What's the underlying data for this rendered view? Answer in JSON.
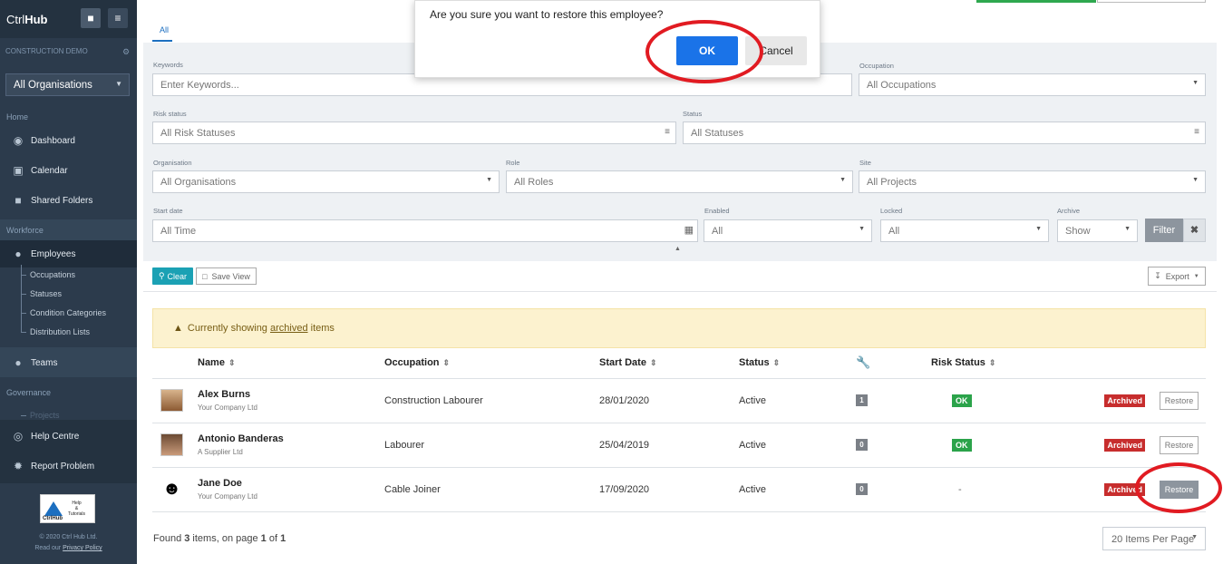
{
  "sidebar": {
    "brand_ctrl": "Ctrl",
    "brand_hub": "Hub",
    "pin_icon": "■",
    "menu_icon": "≡",
    "org_section": "CONSTRUCTION DEMO",
    "org_select": "All Organisations",
    "home_label": "Home",
    "dashboard": "Dashboard",
    "calendar": "Calendar",
    "shared_folders": "Shared Folders",
    "workforce_label": "Workforce",
    "employees": "Employees",
    "occupations": "Occupations",
    "statuses": "Statuses",
    "condition_categories": "Condition Categories",
    "distribution_lists": "Distribution Lists",
    "teams": "Teams",
    "governance_label": "Governance",
    "projects": "Projects",
    "help_centre": "Help Centre",
    "report_problem": "Report Problem",
    "help_logo_text1": "Help",
    "help_logo_text2": "&",
    "help_logo_text3": "Tutorials",
    "help_logo_caption": "CtrlHub",
    "copyright": "© 2020 Ctrl Hub Ltd.",
    "privacy_prefix": "Read our ",
    "privacy_link": "Privacy Policy"
  },
  "tabs": {
    "all": "All"
  },
  "filters": {
    "keywords_label": "Keywords",
    "keywords_placeholder": "Enter Keywords...",
    "occupation_label": "Occupation",
    "occupation_value": "All Occupations",
    "risk_status_label": "Risk status",
    "risk_status_value": "All Risk Statuses",
    "status_label": "Status",
    "status_value": "All Statuses",
    "organisation_label": "Organisation",
    "organisation_value": "All Organisations",
    "role_label": "Role",
    "role_value": "All Roles",
    "site_label": "Site",
    "site_value": "All Projects",
    "start_date_label": "Start date",
    "start_date_value": "All Time",
    "enabled_label": "Enabled",
    "enabled_value": "All",
    "locked_label": "Locked",
    "locked_value": "All",
    "archive_label": "Archive",
    "archive_value": "Show",
    "filter_button": "Filter",
    "clear_x": "✖"
  },
  "toolbar": {
    "clear": "Clear",
    "save_view": "Save View",
    "export": "Export"
  },
  "alert": {
    "prefix": "Currently showing ",
    "link": "archived",
    "suffix": " items"
  },
  "table": {
    "headers": [
      "Name",
      "Occupation",
      "Start Date",
      "Status",
      "",
      "Risk Status"
    ],
    "rows": [
      {
        "name": "Alex Burns",
        "org": "Your Company Ltd",
        "occupation": "Construction Labourer",
        "start_date": "28/01/2020",
        "status": "Active",
        "count": "1",
        "risk": "OK",
        "archived": "Archived",
        "restore": "Restore"
      },
      {
        "name": "Antonio Banderas",
        "org": "A Supplier Ltd",
        "occupation": "Labourer",
        "start_date": "25/04/2019",
        "status": "Active",
        "count": "0",
        "risk": "OK",
        "archived": "Archived",
        "restore": "Restore"
      },
      {
        "name": "Jane Doe",
        "org": "Your Company Ltd",
        "occupation": "Cable Joiner",
        "start_date": "17/09/2020",
        "status": "Active",
        "count": "0",
        "risk": "-",
        "archived": "Archived",
        "restore": "Restore"
      }
    ]
  },
  "footer": {
    "found_prefix": "Found ",
    "found_count": "3",
    "found_mid": " items, on page ",
    "page": "1",
    "found_of": " of ",
    "pages": "1",
    "per_page": "20 Items Per Page"
  },
  "dialog": {
    "message": "Are you sure you want to restore this employee?",
    "ok": "OK",
    "cancel": "Cancel"
  },
  "colors": {
    "sidebar_bg": "#2c3b4c",
    "accent_blue": "#1a73e8",
    "ok_green": "#2ba34a",
    "archived_red": "#c72d2d",
    "annotation_red": "#e11b22"
  }
}
